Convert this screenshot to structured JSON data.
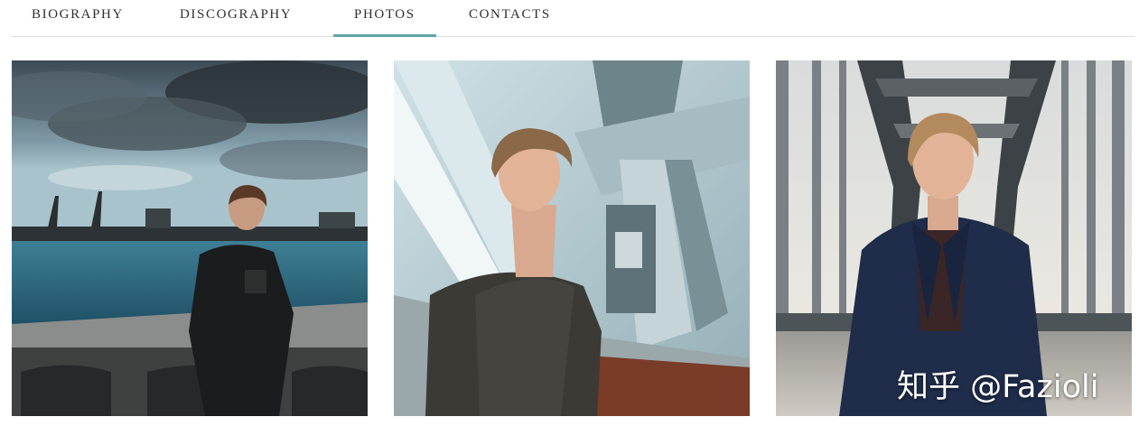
{
  "nav": {
    "tabs": [
      {
        "label": "BIOGRAPHY",
        "active": false
      },
      {
        "label": "DISCOGRAPHY",
        "active": false
      },
      {
        "label": "PHOTOS",
        "active": true
      },
      {
        "label": "CONTACTS",
        "active": false
      }
    ]
  },
  "colors": {
    "accent": "#5fa5ad",
    "divider": "#dedede",
    "tab_text": "#2f2f2f"
  },
  "gallery": {
    "photos": [
      {
        "subject": "harbor-portrait"
      },
      {
        "subject": "crane-portrait"
      },
      {
        "subject": "bridge-portrait"
      }
    ]
  },
  "watermark": {
    "text": "知乎 @Fazioli"
  }
}
